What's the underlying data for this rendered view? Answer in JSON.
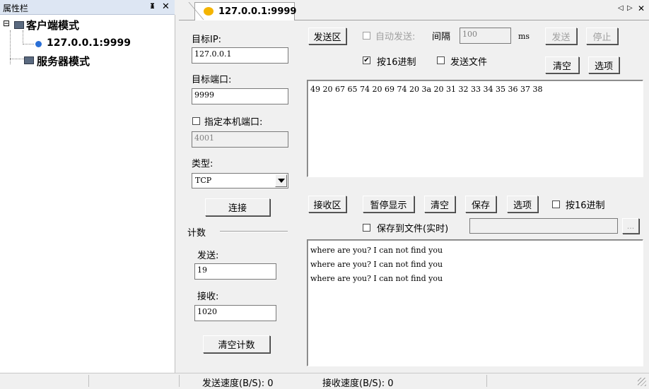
{
  "sidebar": {
    "title": "属性栏",
    "pin_glyph": "ᵻ",
    "close_glyph": "✕",
    "tree": {
      "client_label": "客户端模式",
      "client_child": "127.0.0.1:9999",
      "server_label": "服务器模式",
      "expand_glyph": "⊟"
    }
  },
  "tab": {
    "label": "127.0.0.1:9999",
    "nav_prev": "◁",
    "nav_next": "▷",
    "close": "✕"
  },
  "conn": {
    "target_ip_label": "目标IP:",
    "target_ip": "127.0.0.1",
    "target_port_label": "目标端口:",
    "target_port": "9999",
    "local_port_label": "指定本机端口:",
    "local_port": "4001",
    "type_label": "类型:",
    "type_value": "TCP",
    "connect_btn": "连接",
    "count_label": "计数",
    "sent_label": "发送:",
    "sent_value": "19",
    "recv_label": "接收:",
    "recv_value": "1020",
    "clear_count_btn": "清空计数"
  },
  "send": {
    "area_btn": "发送区",
    "auto_send_label": "自动发送:",
    "interval_label": "间隔",
    "interval_value": "100",
    "interval_unit": "ms",
    "send_btn": "发送",
    "stop_btn": "停止",
    "hex_label": "按16进制",
    "hex_checked": "✔",
    "send_file_label": "发送文件",
    "clear_btn": "清空",
    "options_btn": "选项",
    "content": "49 20 67 65 74 20 69 74 20 3a 20 31 32 33 34 35 36 37 38"
  },
  "recv": {
    "area_btn": "接收区",
    "pause_btn": "暂停显示",
    "clear_btn": "清空",
    "save_btn": "保存",
    "options_btn": "选项",
    "hex_label": "按16进制",
    "save_file_label": "保存到文件(实时)",
    "browse_btn": "...",
    "lines": [
      "where are you? I can not find you",
      "where are you? I can not find you",
      "where are you? I can not find you"
    ]
  },
  "status": {
    "send_speed": "发送速度(B/S): 0",
    "recv_speed": "接收速度(B/S): 0"
  }
}
